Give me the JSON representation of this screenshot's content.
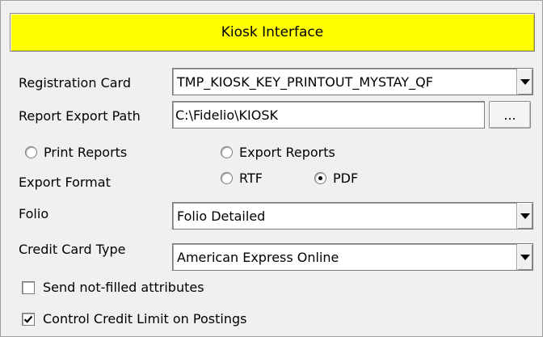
{
  "panel": {
    "title": "Kiosk Interface",
    "header_color": "#ffff00"
  },
  "registration_card": {
    "label": "Registration Card",
    "value": "TMP_KIOSK_KEY_PRINTOUT_MYSTAY_QF"
  },
  "report_export_path": {
    "label": "Report Export Path",
    "value": "C:\\Fidelio\\KIOSK",
    "browse_label": "..."
  },
  "report_mode": {
    "print_label": "Print Reports",
    "export_label": "Export Reports",
    "selected": "none"
  },
  "export_format": {
    "label": "Export Format",
    "rtf_label": "RTF",
    "pdf_label": "PDF",
    "selected": "PDF"
  },
  "folio": {
    "label": "Folio",
    "value": "Folio Detailed"
  },
  "credit_card_type": {
    "label": "Credit Card Type",
    "value": "American Express Online"
  },
  "options": {
    "send_not_filled": {
      "label": "Send not-filled attributes",
      "checked": false
    },
    "control_credit_limit": {
      "label": "Control Credit Limit on Postings",
      "checked": true
    }
  }
}
